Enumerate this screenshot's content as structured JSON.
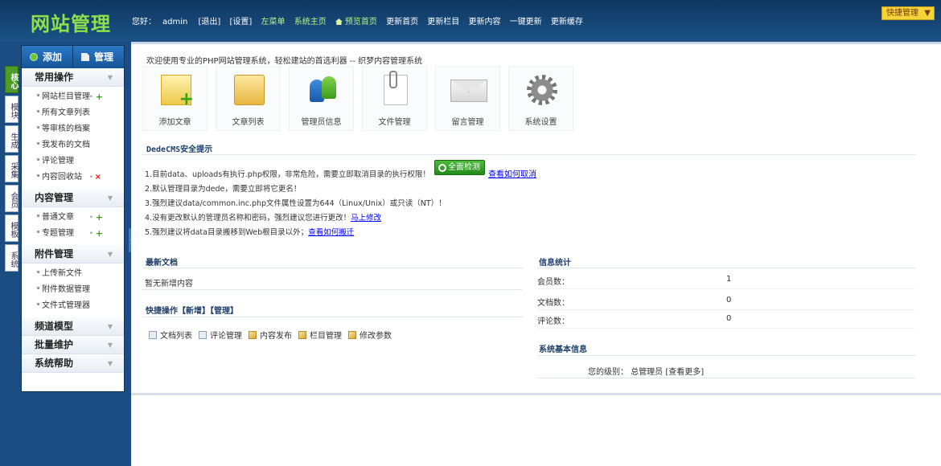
{
  "header": {
    "logo": "网站管理",
    "greeting": "您好：",
    "user": "admin",
    "logout": "[退出]",
    "settings": "[设置]",
    "left_menu": "左菜单",
    "system_home": "系统主页",
    "preview_home": "预览首页",
    "update_home": "更新首页",
    "update_column": "更新栏目",
    "update_content": "更新内容",
    "update_all": "一键更新",
    "update_cache": "更新缓存",
    "quick_manage": "快捷管理",
    "quick_manage_arrow": "▼"
  },
  "sidebar": {
    "tabs": [
      "核心",
      "模块",
      "生成",
      "采集",
      "会员",
      "模板",
      "系统"
    ],
    "top_add": "添加",
    "top_manage": "管理",
    "sections": [
      {
        "title": "常用操作",
        "items": [
          "网站栏目管理",
          "所有文章列表",
          "等审核的档案",
          "我发布的文档",
          "评论管理",
          "内容回收站"
        ]
      },
      {
        "title": "内容管理",
        "items": [
          "普通文章",
          "专题管理"
        ]
      },
      {
        "title": "附件管理",
        "items": [
          "上传新文件",
          "附件数据管理",
          "文件式管理器"
        ]
      },
      {
        "title": "频道模型",
        "items": []
      },
      {
        "title": "批量维护",
        "items": []
      },
      {
        "title": "系统帮助",
        "items": []
      }
    ]
  },
  "main": {
    "welcome": "欢迎使用专业的PHP网站管理系统，轻松建站的首选利器 -- 织梦内容管理系统",
    "quick_icons": [
      "添加文章",
      "文章列表",
      "管理员信息",
      "文件管理",
      "留言管理",
      "系统设置"
    ],
    "security_title": "DedeCMS安全提示",
    "tips": [
      "1.目前data、uploads有执行.php权限，非常危险，需要立即取消目录的执行权限！",
      "2.默认管理目录为dede，需要立即将它更名！",
      "3.强烈建议data/common.inc.php文件属性设置为644（Linux/Unix）或只读（NT）！",
      "4.没有更改默认的管理员名称和密码，强烈建议您进行更改！",
      "5.强烈建议将data目录搬移到Web根目录以外；"
    ],
    "tip4_link": "马上修改",
    "tip5_link": "查看如何搬迁",
    "scan_button": "全面检测",
    "scan_link": "查看如何取消",
    "recent_title": "最新文档",
    "recent_empty": "暂无新增内容",
    "quickops_title": "快捷操作",
    "quickops_add": "【新增】",
    "quickops_manage": "【管理】",
    "quickops": [
      "文档列表",
      "评论管理",
      "内容发布",
      "栏目管理",
      "修改参数"
    ],
    "stats_title": "信息统计",
    "stats": [
      {
        "label": "会员数：",
        "value": "1"
      },
      {
        "label": "文档数：",
        "value": "0"
      },
      {
        "label": "评论数：",
        "value": "0"
      }
    ],
    "sysinfo_title": "系统基本信息",
    "level_label": "您的级别：",
    "level_value": "总管理员",
    "see_more": "[查看更多]"
  }
}
